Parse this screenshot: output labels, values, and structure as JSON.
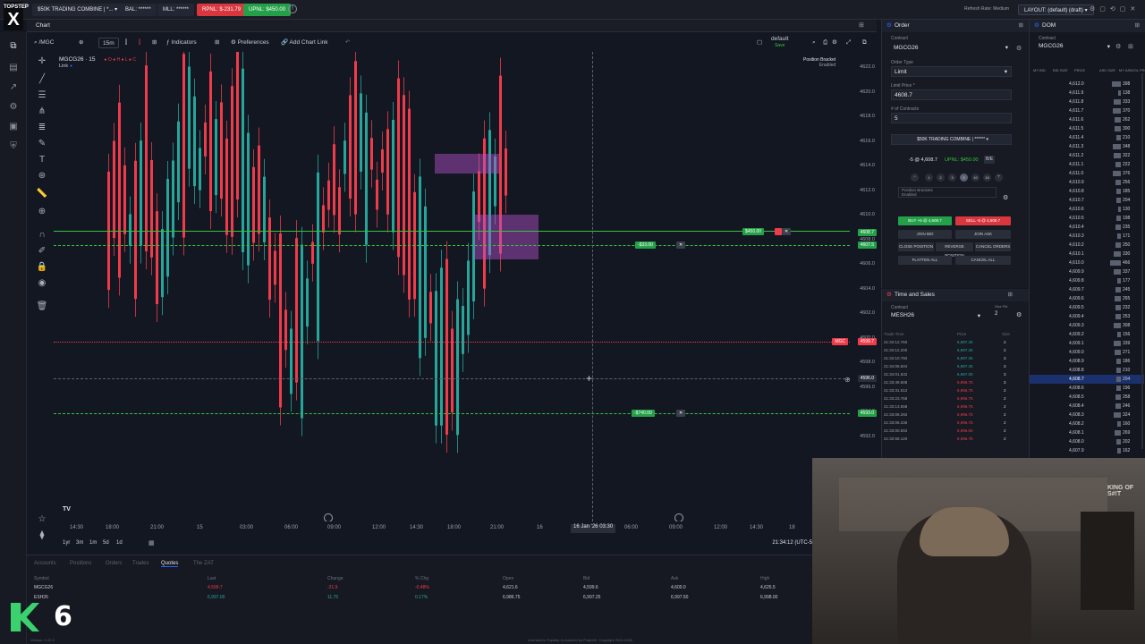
{
  "topbar": {
    "logo_text": "TOPSTEP",
    "account_label": "$50K TRADING COMBINE | *...",
    "balance": "BAL: ******",
    "mll": "MLL: ******",
    "rpnl": "RPNL: $-231.79",
    "upnl": "UPNL: $450.00",
    "refresh_rate": "Refresh Rate: Medium",
    "layout": "LAYOUT: (default) (draft)"
  },
  "chart": {
    "panel_title": "Chart",
    "symbol_search": "/MGC",
    "timeframe": "15m",
    "indicators_label": "Indicators",
    "preferences_label": "Preferences",
    "add_chart_link_label": "Add Chart Link",
    "template_label": "default",
    "template_sub": "Save",
    "legend_symbol": "MGCG26 · 15",
    "link_label": "Link",
    "position_bracket_label": "Position Bracket",
    "position_bracket_value": "Enabled",
    "crosshair_date": "16 Jan '26",
    "crosshair_time": "03:30",
    "clock": "21:34:12 (UTC-5)",
    "price_ticks": [
      "4622.0",
      "4620.0",
      "4618.0",
      "4616.0",
      "4614.0",
      "4612.0",
      "4610.0",
      "4608.0",
      "4606.0",
      "4604.0",
      "4602.0",
      "4600.0",
      "4598.0",
      "4596.0",
      "4594.0",
      "4592.0"
    ],
    "time_ticks": [
      "14:30",
      "18:00",
      "21:00",
      "15",
      "03:00",
      "06:00",
      "09:00",
      "12:00",
      "14:30",
      "18:00",
      "21:00",
      "16",
      "06:00",
      "09:00",
      "12:00",
      "14:30",
      "18"
    ],
    "range_buttons": [
      "1yr",
      "3m",
      "1m",
      "5d",
      "1d"
    ],
    "order_tags": {
      "tp": "$450.00",
      "entry": "-$33.00",
      "stop": "-$740.00",
      "last_symbol": "MGC",
      "last_price": "4599.7",
      "price_4608": "4608.7",
      "price_4607": "4607.5",
      "price_4596": "4596.0",
      "price_4593": "4593.0"
    }
  },
  "quotes": {
    "tabs": [
      "Accounts",
      "Positions",
      "Orders",
      "Trades",
      "Quotes",
      "The ZAT"
    ],
    "active_tab": "Quotes",
    "columns": [
      "Symbol",
      "Last",
      "Change",
      "% Chg",
      "Open",
      "Bid",
      "Ask",
      "High"
    ],
    "rows": [
      {
        "symbol": "MGCG26",
        "last": "4,599.7",
        "change": "-21.9",
        "pct": "-0.48%",
        "open": "4,621.6",
        "bid": "4,599.6",
        "ask": "4,600.0",
        "high": "4,625.5"
      },
      {
        "symbol": "ESH26",
        "last": "6,997.00",
        "change": "11.75",
        "pct": "0.17%",
        "open": "6,986.75",
        "bid": "6,997.25",
        "ask": "6,997.50",
        "high": "6,998.00"
      }
    ],
    "footer_left": "Version: 1.22.0",
    "footer_center": "Licensed to Topstep & powered by ProjectX. Copyright 2024-2026"
  },
  "order": {
    "title": "Order",
    "contract_label": "Contract",
    "contract": "MGCG26",
    "order_type_label": "Order Type",
    "order_type": "Limit",
    "limit_price_label": "Limit Price *",
    "limit_price": "4608.7",
    "contracts_label": "# of Contracts",
    "contracts": "5",
    "account": "$50K TRADING COMBINE | ******",
    "position_summary": "-5 @ 4,608.7",
    "position_upnl": "UPNL: $450.00",
    "be_label": "B/E",
    "qty_buttons": [
      "1",
      "2",
      "3",
      "5",
      "10",
      "15"
    ],
    "bracket_label": "Position Brackets",
    "bracket_value": "Enabled",
    "buy_label": "BUY +5 @ 4,608.7",
    "sell_label": "SELL -5 @ 4,608.7",
    "join_bid": "JOIN BID",
    "join_ask": "JOIN ASK",
    "close_position": "CLOSE POSITION",
    "reverse_position": "REVERSE POSITION",
    "cancel_orders": "CANCEL ORDERS",
    "flatten_all": "FLATTEN ALL",
    "cancel_all": "CANCEL ALL"
  },
  "time_and_sales": {
    "title": "Time and Sales",
    "contract_label": "Contract",
    "contract": "MESH26",
    "size_filter_label": "Size Filt",
    "size_filter": "2",
    "columns": [
      "Trade Time",
      "Price",
      "Size"
    ],
    "rows": [
      {
        "time": "21:34:12.760",
        "price": "6,997.25",
        "size": "2",
        "side": "buy"
      },
      {
        "time": "21:34:12.200",
        "price": "6,997.25",
        "size": "2",
        "side": "buy"
      },
      {
        "time": "21:34:10.792",
        "price": "6,997.25",
        "size": "3",
        "side": "buy"
      },
      {
        "time": "21:34:05.504",
        "price": "6,997.25",
        "size": "3",
        "side": "buy"
      },
      {
        "time": "21:34:01.632",
        "price": "6,997.00",
        "size": "3",
        "side": "buy"
      },
      {
        "time": "21:33:49.608",
        "price": "6,996.75",
        "size": "3",
        "side": "sell"
      },
      {
        "time": "21:33:31.512",
        "price": "6,996.75",
        "size": "2",
        "side": "sell"
      },
      {
        "time": "21:33:23.768",
        "price": "6,996.75",
        "size": "2",
        "side": "sell"
      },
      {
        "time": "21:33:13.558",
        "price": "6,996.75",
        "size": "2",
        "side": "sell"
      },
      {
        "time": "21:33:08.292",
        "price": "6,996.75",
        "size": "2",
        "side": "sell"
      },
      {
        "time": "21:33:06.336",
        "price": "6,996.75",
        "size": "2",
        "side": "sell"
      },
      {
        "time": "21:33:00.592",
        "price": "6,996.50",
        "size": "2",
        "side": "sell"
      },
      {
        "time": "21:32:59.120",
        "price": "6,996.75",
        "size": "2",
        "side": "sell"
      }
    ]
  },
  "dom": {
    "title": "DOM",
    "contract_label": "Contract",
    "contract": "MGCG26",
    "columns": [
      "MY BID",
      "BID SIZE",
      "PRICE",
      "ASK SIZE",
      "MY ASK",
      "VOL PRO"
    ],
    "current_price": "4,608.7",
    "rows": [
      {
        "price": "4,612.0",
        "vol": "398"
      },
      {
        "price": "4,611.9",
        "vol": "138"
      },
      {
        "price": "4,611.8",
        "vol": "333"
      },
      {
        "price": "4,611.7",
        "vol": "370"
      },
      {
        "price": "4,611.6",
        "vol": "262"
      },
      {
        "price": "4,611.5",
        "vol": "300"
      },
      {
        "price": "4,611.4",
        "vol": "210"
      },
      {
        "price": "4,611.3",
        "vol": "348"
      },
      {
        "price": "4,611.2",
        "vol": "322"
      },
      {
        "price": "4,611.1",
        "vol": "222"
      },
      {
        "price": "4,611.0",
        "vol": "376"
      },
      {
        "price": "4,610.9",
        "vol": "256"
      },
      {
        "price": "4,610.8",
        "vol": "185"
      },
      {
        "price": "4,610.7",
        "vol": "204"
      },
      {
        "price": "4,610.6",
        "vol": "130"
      },
      {
        "price": "4,610.5",
        "vol": "198"
      },
      {
        "price": "4,610.4",
        "vol": "235"
      },
      {
        "price": "4,610.3",
        "vol": "171"
      },
      {
        "price": "4,610.2",
        "vol": "250"
      },
      {
        "price": "4,610.1",
        "vol": "330"
      },
      {
        "price": "4,610.0",
        "vol": "466"
      },
      {
        "price": "4,609.9",
        "vol": "337"
      },
      {
        "price": "4,609.8",
        "vol": "177"
      },
      {
        "price": "4,609.7",
        "vol": "245"
      },
      {
        "price": "4,609.6",
        "vol": "265"
      },
      {
        "price": "4,609.5",
        "vol": "232"
      },
      {
        "price": "4,609.4",
        "vol": "253"
      },
      {
        "price": "4,609.3",
        "vol": "308"
      },
      {
        "price": "4,609.2",
        "vol": "156"
      },
      {
        "price": "4,609.1",
        "vol": "339"
      },
      {
        "price": "4,609.0",
        "vol": "271"
      },
      {
        "price": "4,608.9",
        "vol": "186"
      },
      {
        "price": "4,608.8",
        "vol": "210"
      },
      {
        "price": "4,608.7",
        "vol": "204"
      },
      {
        "price": "4,608.6",
        "vol": "196"
      },
      {
        "price": "4,608.5",
        "vol": "258"
      },
      {
        "price": "4,608.4",
        "vol": "246"
      },
      {
        "price": "4,608.3",
        "vol": "324"
      },
      {
        "price": "4,608.2",
        "vol": "160"
      },
      {
        "price": "4,608.1",
        "vol": "269"
      },
      {
        "price": "4,608.0",
        "vol": "202"
      },
      {
        "price": "4,607.9",
        "vol": "162"
      }
    ]
  },
  "webcam": {
    "caption": "KING OF S#!T"
  },
  "watermark": {
    "text": "6"
  },
  "colors": {
    "up": "#26a69a",
    "down": "#ef3b4a",
    "green_line": "#35c53c",
    "accent": "#2962ff"
  }
}
